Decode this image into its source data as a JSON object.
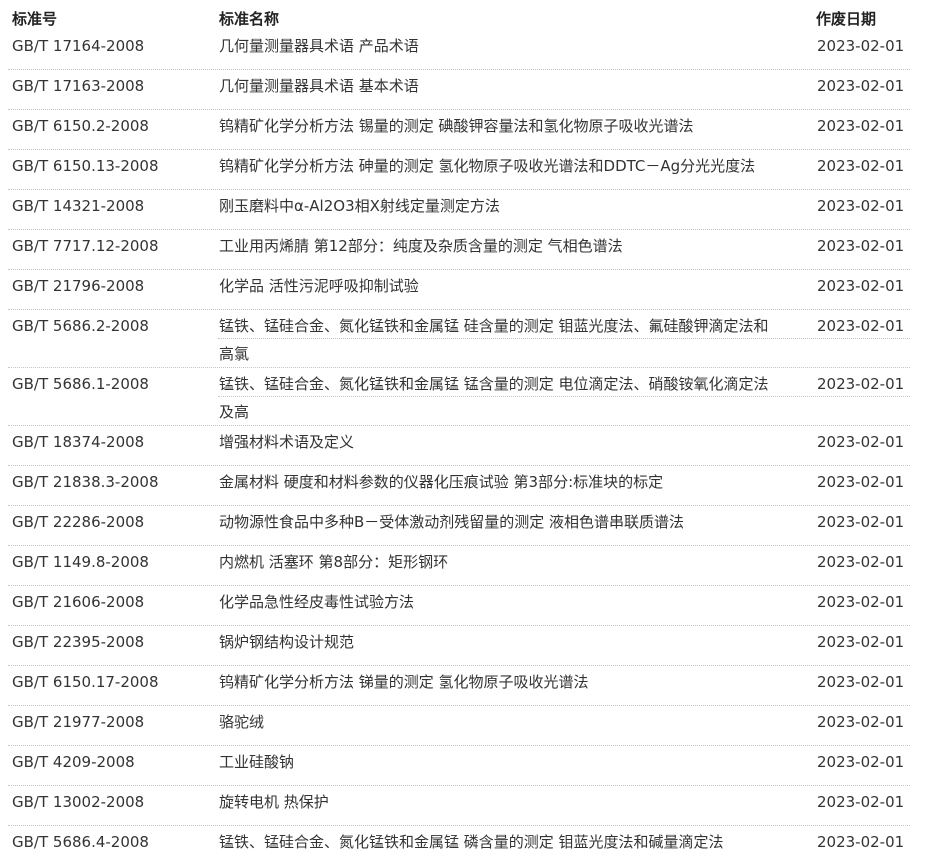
{
  "headers": {
    "code": "标准号",
    "name": "标准名称",
    "date": "作废日期"
  },
  "rows": [
    {
      "code": "GB/T 17164-2008",
      "name": "几何量测量器具术语 产品术语",
      "name2": "",
      "date": "2023-02-01"
    },
    {
      "code": "GB/T 17163-2008",
      "name": "几何量测量器具术语 基本术语",
      "name2": "",
      "date": "2023-02-01"
    },
    {
      "code": "GB/T 6150.2-2008",
      "name": "钨精矿化学分析方法 锡量的测定 碘酸钾容量法和氢化物原子吸收光谱法",
      "name2": "",
      "date": "2023-02-01"
    },
    {
      "code": "GB/T 6150.13-2008",
      "name": "钨精矿化学分析方法 砷量的测定 氢化物原子吸收光谱法和DDTC－Ag分光光度法",
      "name2": "",
      "date": "2023-02-01"
    },
    {
      "code": "GB/T 14321-2008",
      "name": "刚玉磨料中α-Al2O3相X射线定量测定方法",
      "name2": "",
      "date": "2023-02-01"
    },
    {
      "code": "GB/T 7717.12-2008",
      "name": "工业用丙烯腈 第12部分：纯度及杂质含量的测定 气相色谱法",
      "name2": "",
      "date": "2023-02-01"
    },
    {
      "code": "GB/T 21796-2008",
      "name": "化学品 活性污泥呼吸抑制试验",
      "name2": "",
      "date": "2023-02-01"
    },
    {
      "code": "GB/T 5686.2-2008",
      "name": "锰铁、锰硅合金、氮化锰铁和金属锰 硅含量的测定 钼蓝光度法、氟硅酸钾滴定法和",
      "name2": "高氯",
      "date": "2023-02-01"
    },
    {
      "code": "GB/T 5686.1-2008",
      "name": "锰铁、锰硅合金、氮化锰铁和金属锰 锰含量的测定 电位滴定法、硝酸铵氧化滴定法",
      "name2": "及高",
      "date": "2023-02-01"
    },
    {
      "code": "GB/T 18374-2008",
      "name": "增强材料术语及定义",
      "name2": "",
      "date": "2023-02-01"
    },
    {
      "code": "GB/T 21838.3-2008",
      "name": "金属材料 硬度和材料参数的仪器化压痕试验 第3部分:标准块的标定",
      "name2": "",
      "date": "2023-02-01"
    },
    {
      "code": "GB/T 22286-2008",
      "name": "动物源性食品中多种B－受体激动剂残留量的测定 液相色谱串联质谱法",
      "name2": "",
      "date": "2023-02-01"
    },
    {
      "code": "GB/T 1149.8-2008",
      "name": "内燃机 活塞环 第8部分：矩形钢环",
      "name2": "",
      "date": "2023-02-01"
    },
    {
      "code": "GB/T 21606-2008",
      "name": "化学品急性经皮毒性试验方法",
      "name2": "",
      "date": "2023-02-01"
    },
    {
      "code": "GB/T 22395-2008",
      "name": "锅炉钢结构设计规范",
      "name2": "",
      "date": "2023-02-01"
    },
    {
      "code": "GB/T 6150.17-2008",
      "name": "钨精矿化学分析方法 锑量的测定 氢化物原子吸收光谱法",
      "name2": "",
      "date": "2023-02-01"
    },
    {
      "code": "GB/T 21977-2008",
      "name": "骆驼绒",
      "name2": "",
      "date": "2023-02-01"
    },
    {
      "code": "GB/T 4209-2008",
      "name": "工业硅酸钠",
      "name2": "",
      "date": "2023-02-01"
    },
    {
      "code": "GB/T 13002-2008",
      "name": "旋转电机 热保护",
      "name2": "",
      "date": "2023-02-01"
    },
    {
      "code": "GB/T 5686.4-2008",
      "name": "锰铁、锰硅合金、氮化锰铁和金属锰 磷含量的测定 钼蓝光度法和碱量滴定法",
      "name2": "",
      "date": "2023-02-01"
    }
  ]
}
